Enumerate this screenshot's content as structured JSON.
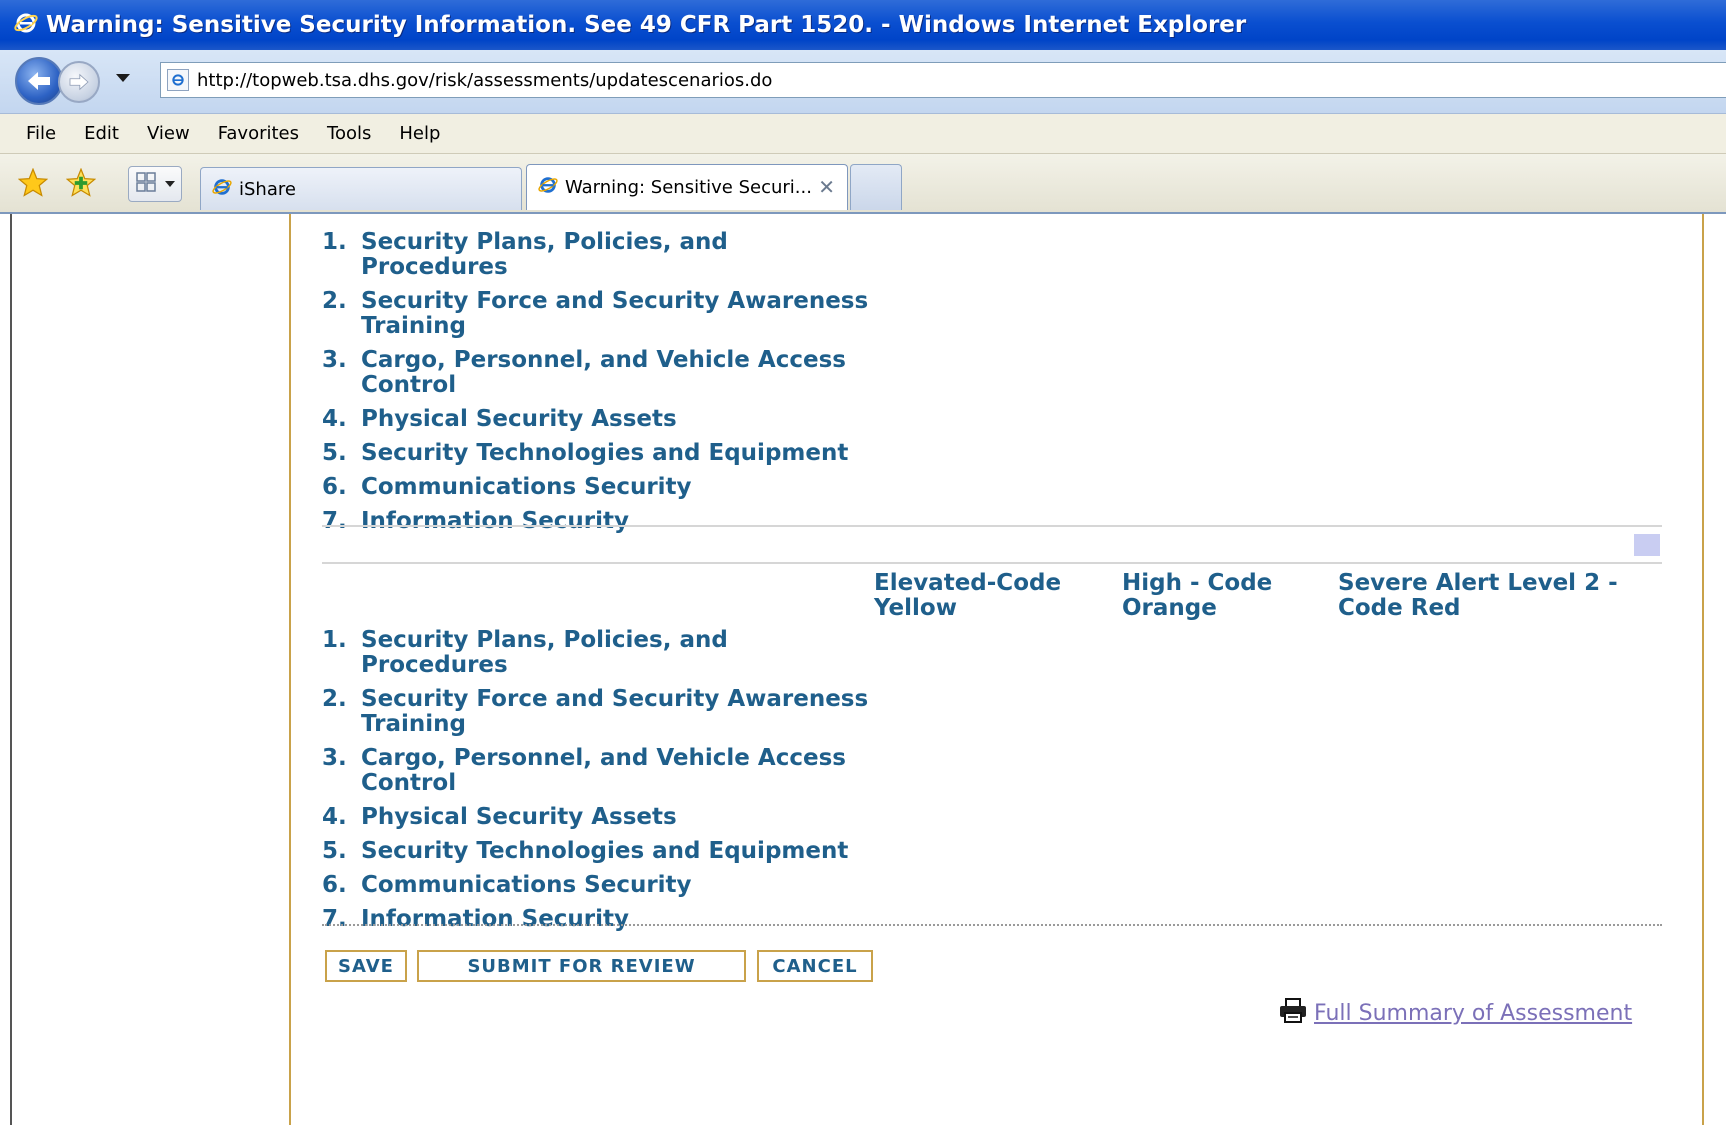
{
  "window": {
    "title": "Warning: Sensitive Security Information. See 49 CFR Part 1520. - Windows Internet Explorer"
  },
  "address_bar": {
    "url": "http://topweb.tsa.dhs.gov/risk/assessments/updatescenarios.do"
  },
  "menu": {
    "items": [
      "File",
      "Edit",
      "View",
      "Favorites",
      "Tools",
      "Help"
    ]
  },
  "tabs": [
    {
      "label": "iShare",
      "active": false
    },
    {
      "label": "Warning: Sensitive Securi...",
      "active": true
    }
  ],
  "categories_1": [
    {
      "num": "1.",
      "label": "Security Plans, Policies, and Procedures"
    },
    {
      "num": "2.",
      "label": "Security Force and Security Awareness Training"
    },
    {
      "num": "3.",
      "label": "Cargo, Personnel, and Vehicle Access Control"
    },
    {
      "num": "4.",
      "label": "Physical Security Assets"
    },
    {
      "num": "5.",
      "label": "Security Technologies and Equipment"
    },
    {
      "num": "6.",
      "label": "Communications Security"
    },
    {
      "num": "7.",
      "label": "Information Security"
    }
  ],
  "threat_levels": [
    "Elevated-Code Yellow",
    "High - Code Orange",
    "Severe Alert Level 2 - Code Red"
  ],
  "categories_2": [
    {
      "num": "1.",
      "label": "Security Plans, Policies, and Procedures"
    },
    {
      "num": "2.",
      "label": "Security Force and Security Awareness Training"
    },
    {
      "num": "3.",
      "label": "Cargo, Personnel, and Vehicle Access Control"
    },
    {
      "num": "4.",
      "label": "Physical Security Assets"
    },
    {
      "num": "5.",
      "label": "Security Technologies and Equipment"
    },
    {
      "num": "6.",
      "label": "Communications Security"
    },
    {
      "num": "7.",
      "label": "Information Security"
    }
  ],
  "buttons": {
    "save": "SAVE",
    "submit": "SUBMIT FOR REVIEW",
    "cancel": "CANCEL"
  },
  "summary_link": "Full Summary of Assessment",
  "colors": {
    "title_bar": "#0a4fd0",
    "heading_text": "#1f5f8b",
    "link_visited": "#7b70b8",
    "button_border": "#c9a24a",
    "column_border": "#c9a24a"
  }
}
